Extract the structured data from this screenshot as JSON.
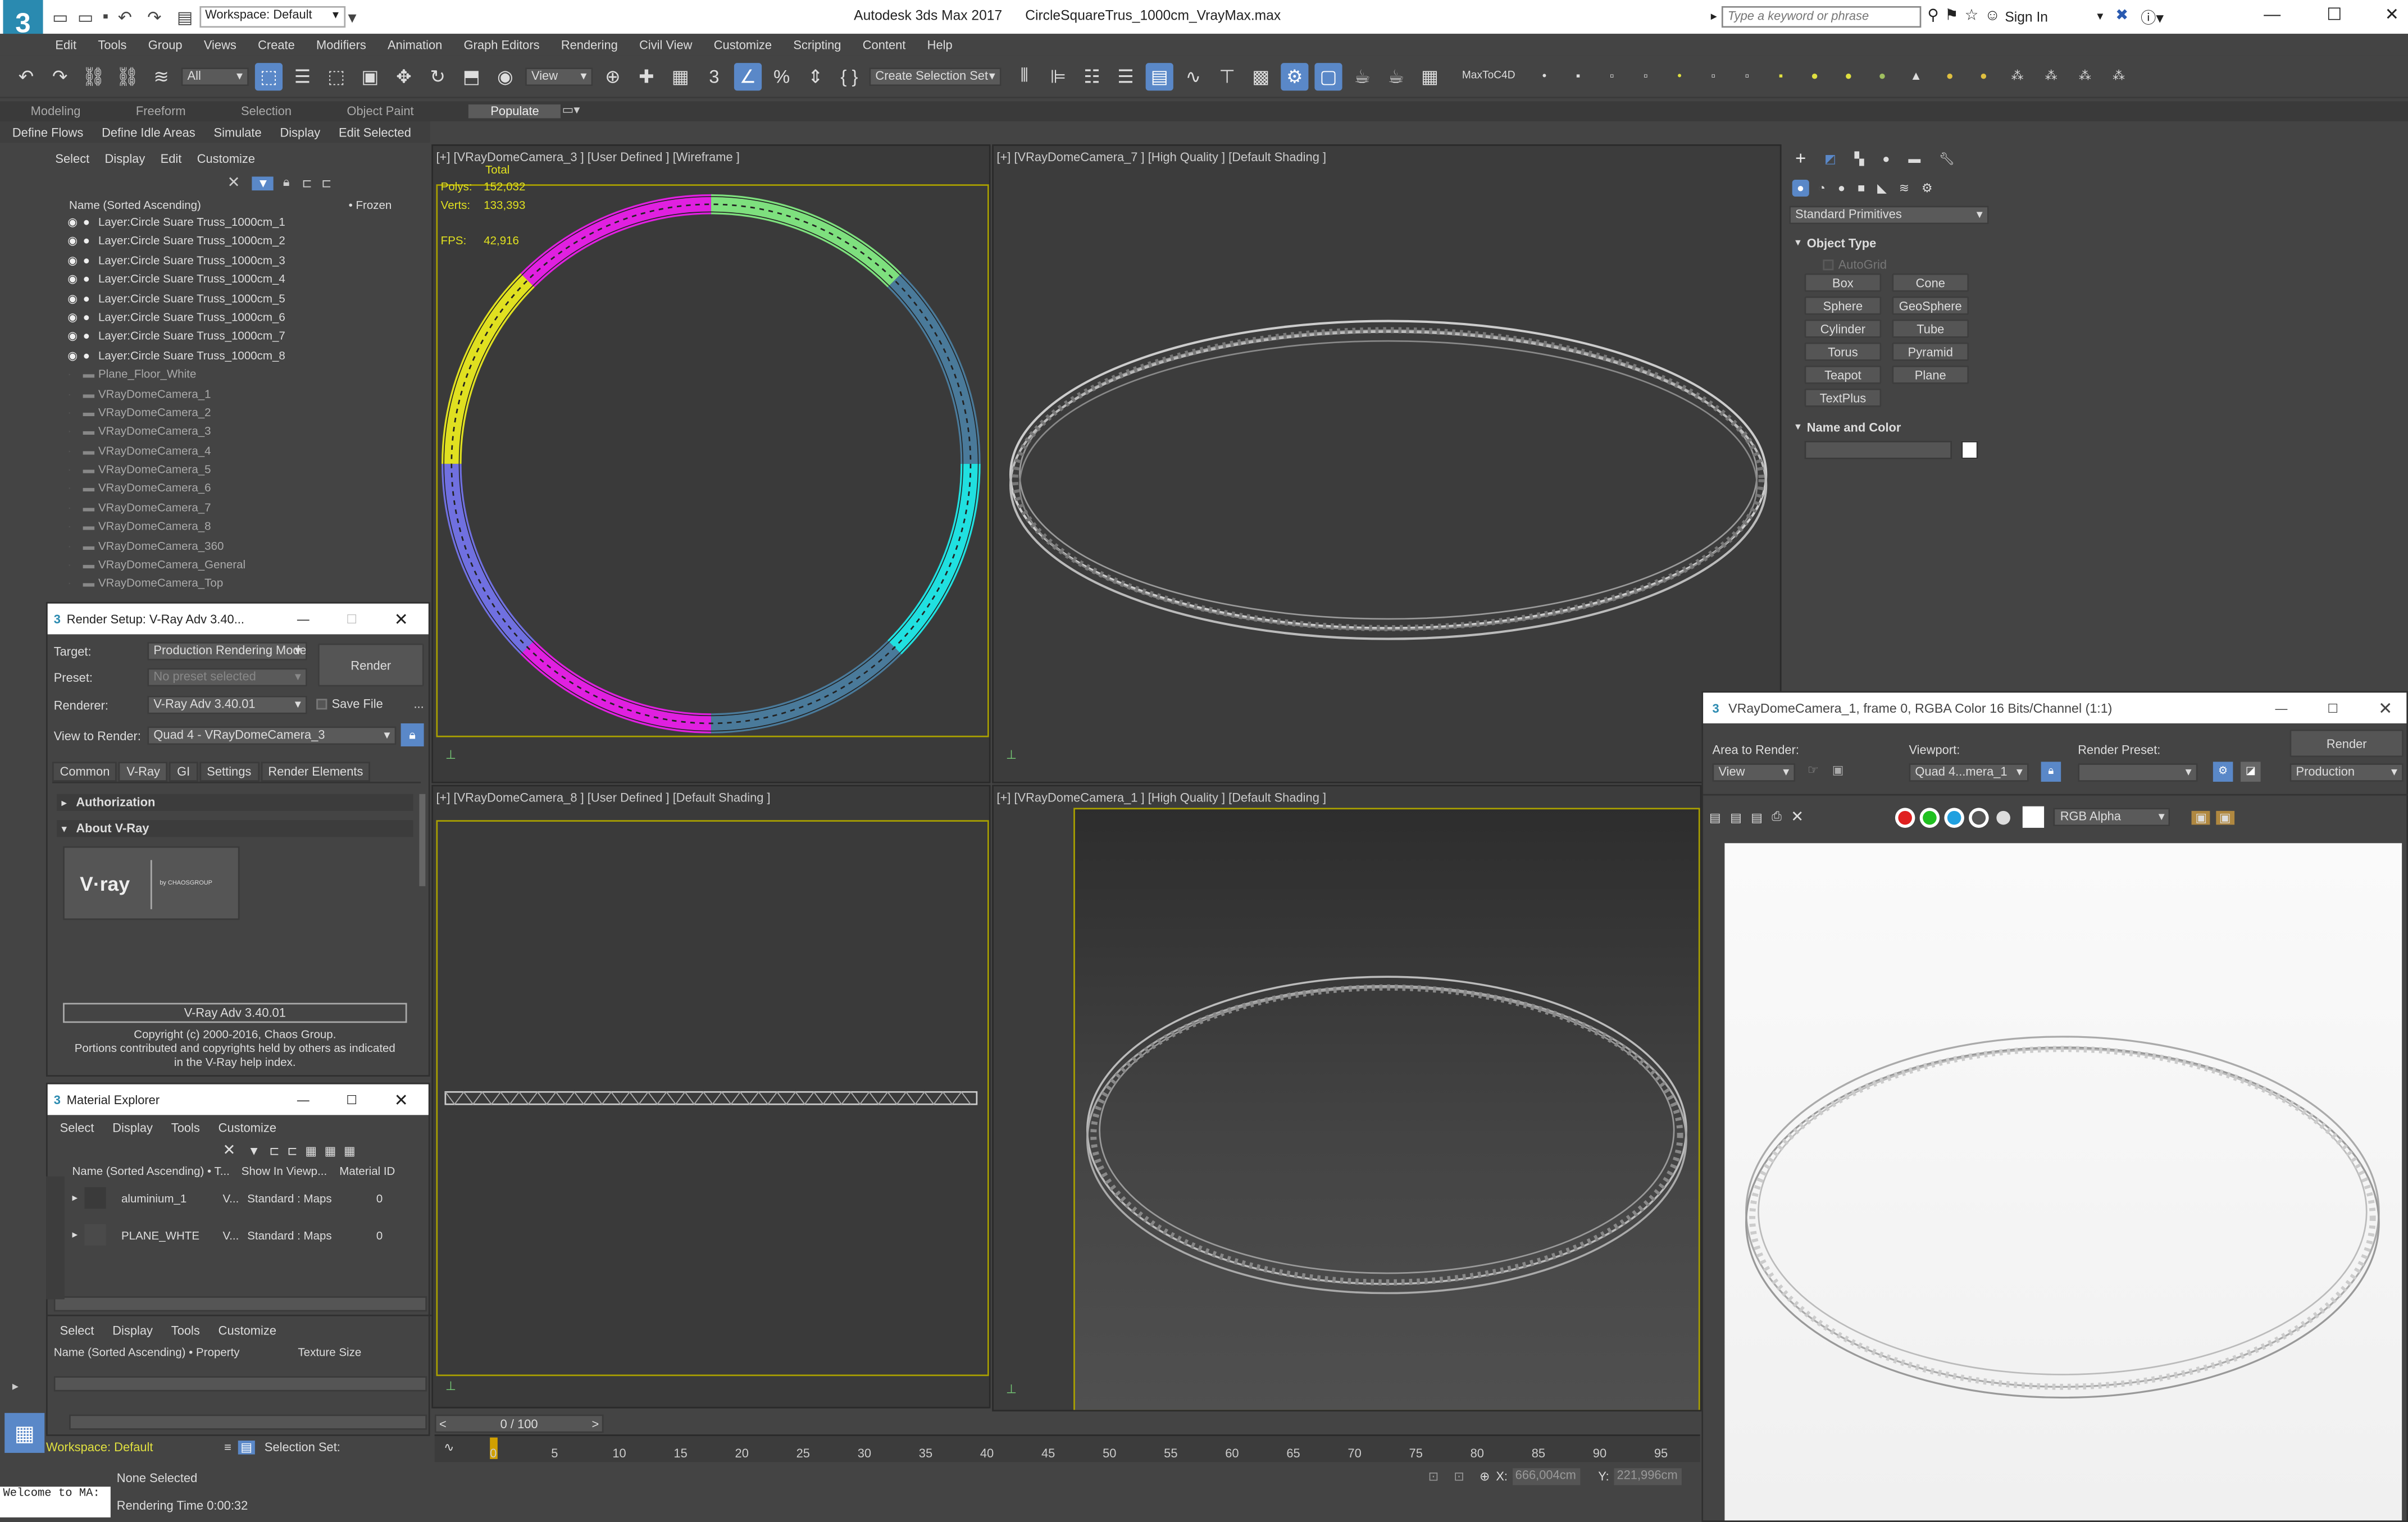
{
  "window": {
    "title": "Autodesk 3ds Max 2017",
    "file": "CircleSquareTrus_1000cm_VrayMax.max",
    "workspace": "Workspace: Default",
    "search_placeholder": "Type a keyword or phrase",
    "sign_in": "Sign In"
  },
  "menu": [
    "Edit",
    "Tools",
    "Group",
    "Views",
    "Create",
    "Modifiers",
    "Animation",
    "Graph Editors",
    "Rendering",
    "Civil View",
    "Customize",
    "Scripting",
    "Content",
    "Help"
  ],
  "toolbar": {
    "filter": "All",
    "ref_coord": "View",
    "selection_set": "Create Selection Set",
    "plugin": "MaxToC4D"
  },
  "ribbon": {
    "tabs": [
      "Modeling",
      "Freeform",
      "Selection",
      "Object Paint",
      "Populate"
    ],
    "active": "Populate",
    "sub": [
      "Define Flows",
      "Define Idle Areas",
      "Simulate",
      "Display",
      "Edit Selected"
    ]
  },
  "scene_explorer": {
    "menu": [
      "Select",
      "Display",
      "Edit",
      "Customize"
    ],
    "col_name": "Name (Sorted Ascending)",
    "col_frozen": "• Frozen",
    "rows": [
      "Layer:Circle Suare Truss_1000cm_1",
      "Layer:Circle Suare Truss_1000cm_2",
      "Layer:Circle Suare Truss_1000cm_3",
      "Layer:Circle Suare Truss_1000cm_4",
      "Layer:Circle Suare Truss_1000cm_5",
      "Layer:Circle Suare Truss_1000cm_6",
      "Layer:Circle Suare Truss_1000cm_7",
      "Layer:Circle Suare Truss_1000cm_8",
      "Plane_Floor_White",
      "VRayDomeCamera_1",
      "VRayDomeCamera_2",
      "VRayDomeCamera_3",
      "VRayDomeCamera_4",
      "VRayDomeCamera_5",
      "VRayDomeCamera_6",
      "VRayDomeCamera_7",
      "VRayDomeCamera_8",
      "VRayDomeCamera_360",
      "VRayDomeCamera_General",
      "VRayDomeCamera_Top"
    ]
  },
  "render_setup": {
    "title": "Render Setup: V-Ray Adv 3.40...",
    "target_label": "Target:",
    "target": "Production Rendering Mode",
    "preset_label": "Preset:",
    "preset": "No preset selected",
    "renderer_label": "Renderer:",
    "renderer": "V-Ray Adv 3.40.01",
    "save_file": "Save File",
    "render_btn": "Render",
    "view_label": "View to Render:",
    "view": "Quad 4 - VRayDomeCamera_3",
    "tabs": [
      "Common",
      "V-Ray",
      "GI",
      "Settings",
      "Render Elements"
    ],
    "active_tab": "V-Ray",
    "rollout1": "Authorization",
    "rollout2": "About V-Ray",
    "logo": "V·ray",
    "logo_sub": "by CHAOSGROUP",
    "version": "V-Ray Adv 3.40.01",
    "copyright": "Copyright (c) 2000-2016, Chaos Group.",
    "portions": "Portions contributed and copyrights held by others as indicated",
    "help": "in the V-Ray help index."
  },
  "material_explorer": {
    "title": "Material Explorer",
    "menu": [
      "Select",
      "Display",
      "Tools",
      "Customize"
    ],
    "cols": [
      "Name (Sorted Ascending) • T...",
      "Show In Viewp...",
      "Material ID"
    ],
    "rows": [
      {
        "name": "aluminium_1",
        "t": "V...",
        "type": "Standard : Maps",
        "id": "0"
      },
      {
        "name": "PLANE_WHTE",
        "t": "V...",
        "type": "Standard : Maps",
        "id": "0"
      }
    ],
    "menu2": [
      "Select",
      "Display",
      "Tools",
      "Customize"
    ],
    "cols2": [
      "Name (Sorted Ascending) • Property",
      "Texture Size"
    ]
  },
  "viewports": {
    "tl": "[+] [VRayDomeCamera_3 ] [User Defined ] [Wireframe ]",
    "tr": "[+] [VRayDomeCamera_7 ] [High Quality ] [Default Shading ]",
    "bl": "[+] [VRayDomeCamera_8 ] [User Defined ] [Default Shading ]",
    "br": "[+] [VRayDomeCamera_1 ] [High Quality ] [Default Shading ]",
    "stats": {
      "total": "Total",
      "polys_label": "Polys:",
      "polys": "152,032",
      "verts_label": "Verts:",
      "verts": "133,393",
      "fps_label": "FPS:",
      "fps": "42,916"
    }
  },
  "command_panel": {
    "dropdown": "Standard Primitives",
    "rollout": "Object Type",
    "autogrid": "AutoGrid",
    "buttons": [
      "Box",
      "Cone",
      "Sphere",
      "GeoSphere",
      "Cylinder",
      "Tube",
      "Torus",
      "Pyramid",
      "Teapot",
      "Plane",
      "TextPlus"
    ],
    "rollout2": "Name and Color"
  },
  "frame_buffer": {
    "title": "VRayDomeCamera_1, frame 0, RGBA Color 16 Bits/Channel (1:1)",
    "area_label": "Area to Render:",
    "area": "View",
    "viewport_label": "Viewport:",
    "viewport": "Quad 4...mera_1",
    "preset_label": "Render Preset:",
    "render_btn": "Render",
    "mode": "Production",
    "channel": "RGB Alpha"
  },
  "timeline": {
    "frame": "0 / 100",
    "ticks": [
      "0",
      "5",
      "10",
      "15",
      "20",
      "25",
      "30",
      "35",
      "40",
      "45",
      "50",
      "55",
      "60",
      "65",
      "70",
      "75",
      "80",
      "85",
      "90",
      "95"
    ]
  },
  "status": {
    "workspace": "Workspace: Default",
    "selection_set": "Selection Set:",
    "none_selected": "None Selected",
    "render_time": "Rendering Time  0:00:32",
    "listener": "Welcome to MA:",
    "x_label": "X:",
    "x": "666,004cm",
    "y_label": "Y:",
    "y": "221,996cm"
  },
  "colors": {
    "accent": "#5a88c8",
    "ring_magenta": "#e020e0",
    "ring_green": "#7ee07e",
    "ring_blue": "#4a7a9a",
    "ring_cyan": "#20e0e0",
    "ring_purple": "#7070e0",
    "ring_yellow": "#e0e020"
  }
}
